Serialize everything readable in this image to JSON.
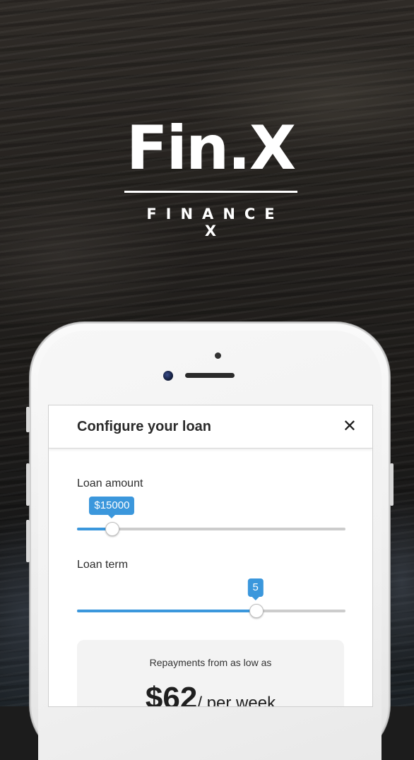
{
  "brand": {
    "wordmark": "Fin.X",
    "tagline": "FINANCE X"
  },
  "modal": {
    "title": "Configure your loan",
    "close_icon": "close-icon",
    "close_glyph": "✕"
  },
  "loan_amount": {
    "label": "Loan amount",
    "value_display": "$15000",
    "fraction": 0.13
  },
  "loan_term": {
    "label": "Loan term",
    "value_display": "5",
    "fraction": 0.665
  },
  "repayment": {
    "caption": "Repayments from as low as",
    "amount": "$62",
    "period": "/ per week"
  },
  "colors": {
    "accent": "#3b97dc",
    "track": "#cccccc",
    "card": "#f3f3f3"
  }
}
